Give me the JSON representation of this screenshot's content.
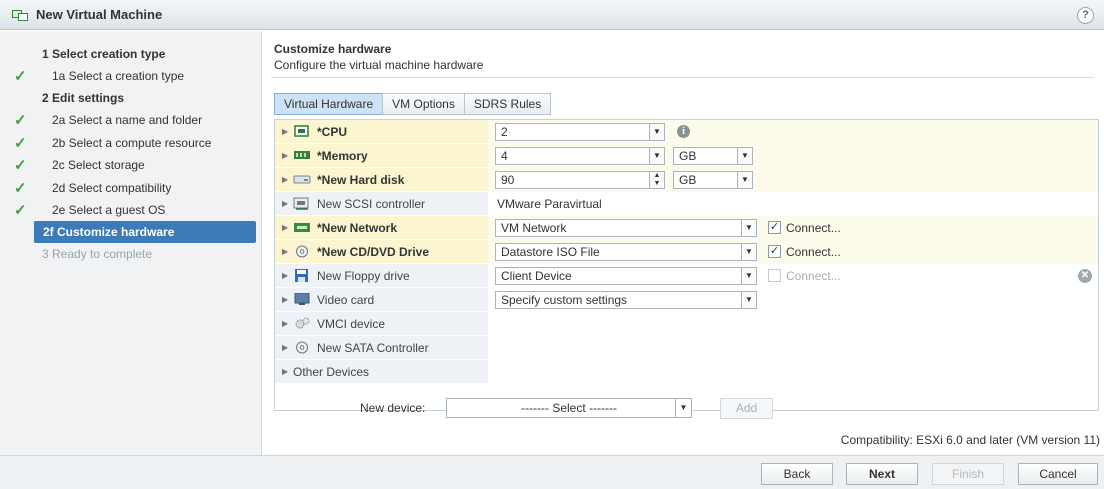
{
  "window": {
    "title": "New Virtual Machine",
    "help_label": "?"
  },
  "steps": [
    {
      "label": "1 Select creation type",
      "kind": "group",
      "done": false
    },
    {
      "label": "1a Select a creation type",
      "kind": "sub",
      "done": true
    },
    {
      "label": "2 Edit settings",
      "kind": "group",
      "done": false
    },
    {
      "label": "2a Select a name and folder",
      "kind": "sub",
      "done": true
    },
    {
      "label": "2b Select a compute resource",
      "kind": "sub",
      "done": true
    },
    {
      "label": "2c Select storage",
      "kind": "sub",
      "done": true
    },
    {
      "label": "2d Select compatibility",
      "kind": "sub",
      "done": true
    },
    {
      "label": "2e Select a guest OS",
      "kind": "sub",
      "done": true
    },
    {
      "label": "2f Customize hardware",
      "kind": "active",
      "done": false
    },
    {
      "label": "3 Ready to complete",
      "kind": "disabled",
      "done": false
    }
  ],
  "check_glyph": "✓",
  "header": {
    "title": "Customize hardware",
    "subtitle": "Configure the virtual machine hardware"
  },
  "tabs": [
    {
      "label": "Virtual Hardware",
      "active": true
    },
    {
      "label": "VM Options",
      "active": false
    },
    {
      "label": "SDRS Rules",
      "active": false
    }
  ],
  "hardware": {
    "cpu": {
      "name": "*CPU",
      "value": "2"
    },
    "memory": {
      "name": "*Memory",
      "value": "4",
      "unit": "GB"
    },
    "disk": {
      "name": "*New Hard disk",
      "value": "90",
      "unit": "GB"
    },
    "scsi": {
      "name": "New SCSI controller",
      "value": "VMware Paravirtual"
    },
    "network": {
      "name": "*New Network",
      "value": "VM Network",
      "connect": "Connect...",
      "connected": true
    },
    "cdrom": {
      "name": "*New CD/DVD Drive",
      "value": "Datastore ISO File",
      "connect": "Connect...",
      "connected": true
    },
    "floppy": {
      "name": "New Floppy drive",
      "value": "Client Device",
      "connect": "Connect...",
      "connected": false
    },
    "video": {
      "name": "Video card",
      "value": "Specify custom settings"
    },
    "vmci": {
      "name": "VMCI device"
    },
    "sata": {
      "name": "New SATA Controller"
    },
    "other": {
      "name": "Other Devices"
    }
  },
  "new_device": {
    "label": "New device:",
    "select": "------- Select -------",
    "add": "Add"
  },
  "compatibility": "Compatibility: ESXi 6.0 and later (VM version 11)",
  "footer": {
    "back": "Back",
    "next": "Next",
    "finish": "Finish",
    "cancel": "Cancel"
  },
  "colors": {
    "accent": "#3d7ab8",
    "check": "#3f9f3f",
    "edited_row": "#fbf6cf"
  }
}
